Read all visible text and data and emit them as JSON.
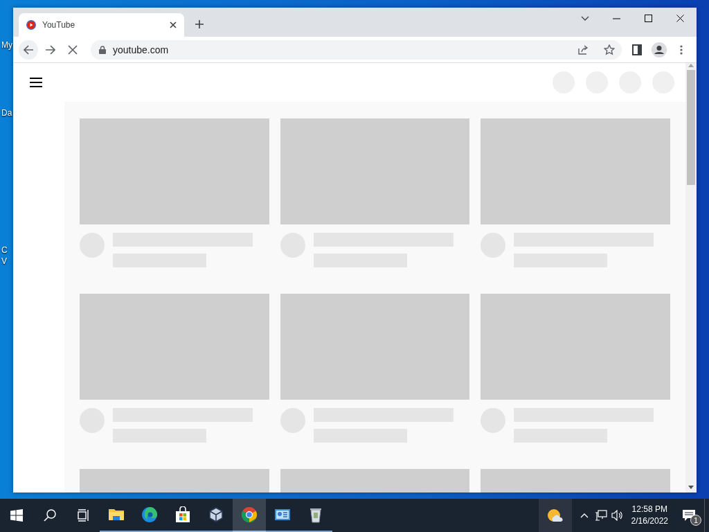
{
  "desktop_icons": [
    {
      "label": "My"
    },
    {
      "label": "Da"
    },
    {
      "label": "C"
    },
    {
      "label": "V"
    }
  ],
  "browser": {
    "tabs": [
      {
        "title": "YouTube",
        "selected": true
      }
    ],
    "address": "youtube.com",
    "loading": true,
    "bookmarked": false,
    "video_grid": [
      {
        "kind": "skeleton"
      },
      {
        "kind": "skeleton"
      },
      {
        "kind": "skeleton"
      },
      {
        "kind": "skeleton"
      },
      {
        "kind": "skeleton"
      },
      {
        "kind": "skeleton"
      },
      {
        "kind": "thumbnail_only"
      },
      {
        "kind": "thumbnail_only"
      },
      {
        "kind": "thumbnail_only"
      }
    ]
  },
  "taskbar": {
    "apps": [
      {
        "kind": "explorer",
        "selected": false
      },
      {
        "kind": "edge",
        "selected": false
      },
      {
        "kind": "store",
        "selected": false
      },
      {
        "kind": "virtualbox",
        "selected": false
      },
      {
        "kind": "chrome",
        "selected": true
      },
      {
        "kind": "control",
        "selected": false
      },
      {
        "kind": "recycle",
        "selected": false
      }
    ],
    "time": "12:58 PM",
    "date": "2/16/2022",
    "notifications": "1"
  }
}
